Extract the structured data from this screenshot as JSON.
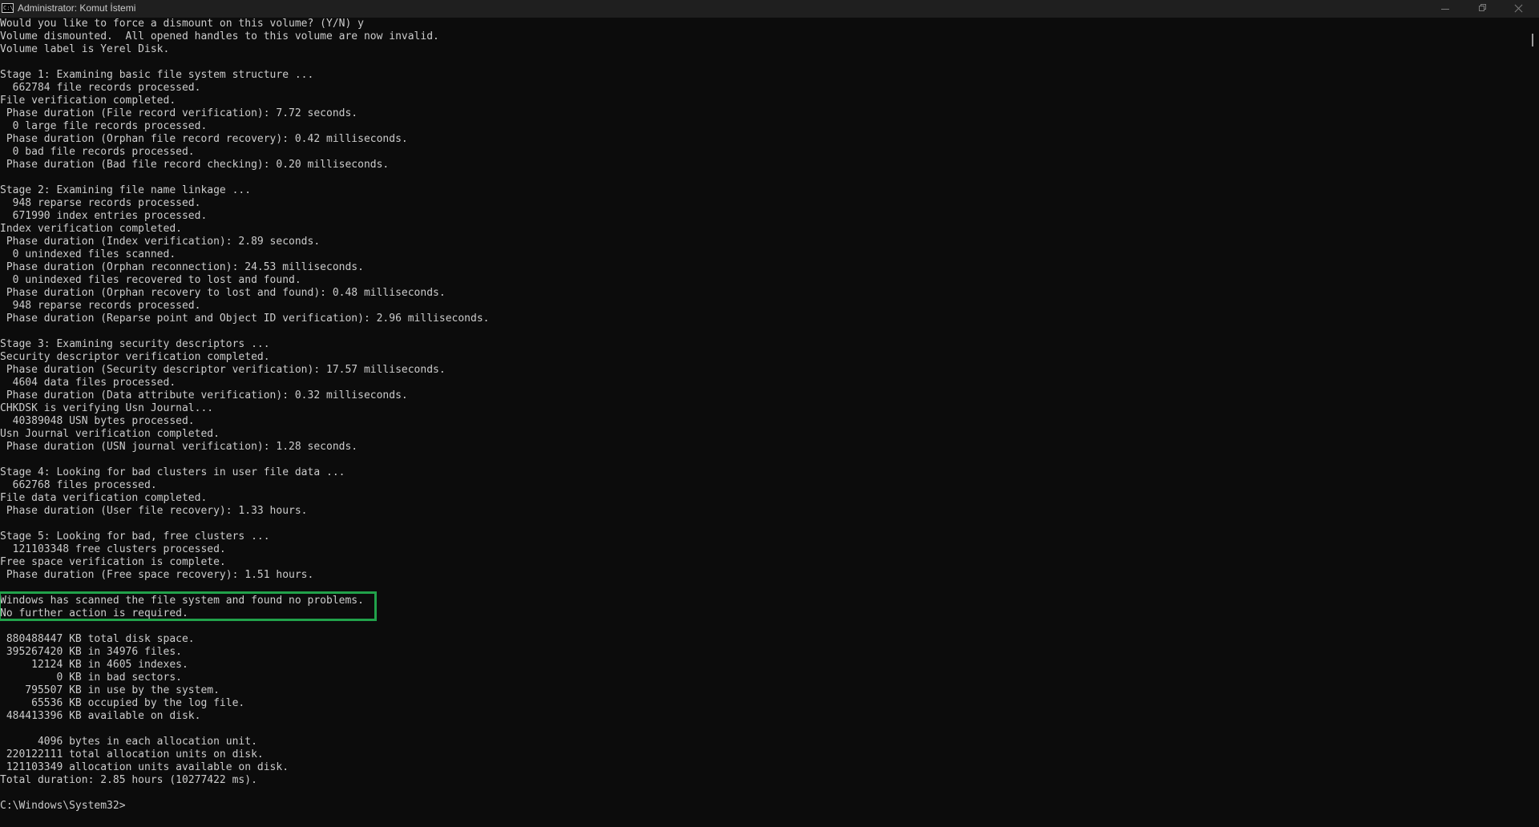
{
  "window": {
    "title": "Administrator: Komut İstemi",
    "icon_label": "C:\\",
    "colors": {
      "background": "#0c0c0c",
      "text": "#cccccc",
      "highlight_border": "#21a24a"
    }
  },
  "console": {
    "lines": [
      "Would you like to force a dismount on this volume? (Y/N) y",
      "Volume dismounted.  All opened handles to this volume are now invalid.",
      "Volume label is Yerel Disk.",
      "",
      "Stage 1: Examining basic file system structure ...",
      "  662784 file records processed.",
      "File verification completed.",
      " Phase duration (File record verification): 7.72 seconds.",
      "  0 large file records processed.",
      " Phase duration (Orphan file record recovery): 0.42 milliseconds.",
      "  0 bad file records processed.",
      " Phase duration (Bad file record checking): 0.20 milliseconds.",
      "",
      "Stage 2: Examining file name linkage ...",
      "  948 reparse records processed.",
      "  671990 index entries processed.",
      "Index verification completed.",
      " Phase duration (Index verification): 2.89 seconds.",
      "  0 unindexed files scanned.",
      " Phase duration (Orphan reconnection): 24.53 milliseconds.",
      "  0 unindexed files recovered to lost and found.",
      " Phase duration (Orphan recovery to lost and found): 0.48 milliseconds.",
      "  948 reparse records processed.",
      " Phase duration (Reparse point and Object ID verification): 2.96 milliseconds.",
      "",
      "Stage 3: Examining security descriptors ...",
      "Security descriptor verification completed.",
      " Phase duration (Security descriptor verification): 17.57 milliseconds.",
      "  4604 data files processed.",
      " Phase duration (Data attribute verification): 0.32 milliseconds.",
      "CHKDSK is verifying Usn Journal...",
      "  40389048 USN bytes processed.",
      "Usn Journal verification completed.",
      " Phase duration (USN journal verification): 1.28 seconds.",
      "",
      "Stage 4: Looking for bad clusters in user file data ...",
      "  662768 files processed.",
      "File data verification completed.",
      " Phase duration (User file recovery): 1.33 hours.",
      "",
      "Stage 5: Looking for bad, free clusters ...",
      "  121103348 free clusters processed.",
      "Free space verification is complete.",
      " Phase duration (Free space recovery): 1.51 hours.",
      "",
      "Windows has scanned the file system and found no problems.",
      "No further action is required.",
      "",
      " 880488447 KB total disk space.",
      " 395267420 KB in 34976 files.",
      "     12124 KB in 4605 indexes.",
      "         0 KB in bad sectors.",
      "    795507 KB in use by the system.",
      "     65536 KB occupied by the log file.",
      " 484413396 KB available on disk.",
      "",
      "      4096 bytes in each allocation unit.",
      " 220122111 total allocation units on disk.",
      " 121103349 allocation units available on disk.",
      "Total duration: 2.85 hours (10277422 ms).",
      "",
      "C:\\Windows\\System32>"
    ]
  }
}
